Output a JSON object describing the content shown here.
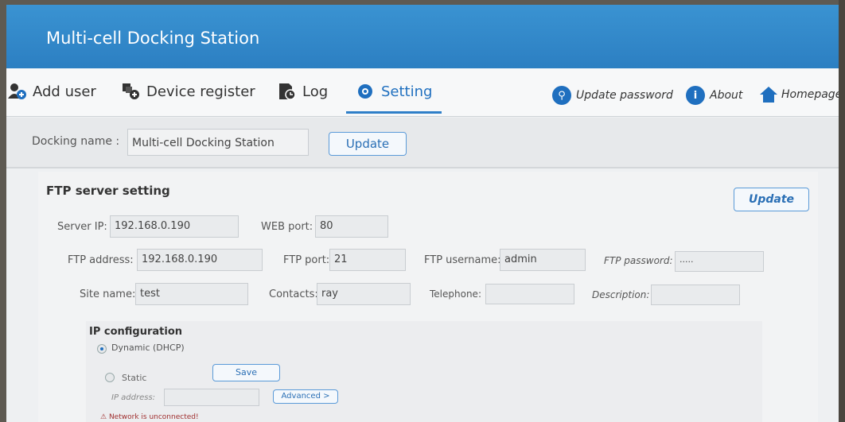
{
  "app": {
    "title": "Multi-cell Docking Station"
  },
  "nav": {
    "tabs": [
      {
        "label": "Add user",
        "icon": "add-user-icon"
      },
      {
        "label": "Device register",
        "icon": "device-register-icon"
      },
      {
        "label": "Log",
        "icon": "log-icon"
      },
      {
        "label": "Setting",
        "icon": "gear-icon"
      }
    ],
    "active_tab": "Setting",
    "links": [
      {
        "label": "Update password",
        "icon": "search-icon"
      },
      {
        "label": "About",
        "icon": "info-icon"
      },
      {
        "label": "Homepage",
        "icon": "home-icon"
      }
    ]
  },
  "docking": {
    "label": "Docking name :",
    "value": "Multi-cell Docking Station",
    "update_label": "Update"
  },
  "ftp": {
    "title": "FTP server setting",
    "update_label": "Update",
    "server_ip_label": "Server IP:",
    "server_ip": "192.168.0.190",
    "web_port_label": "WEB port:",
    "web_port": "80",
    "ftp_address_label": "FTP address:",
    "ftp_address": "192.168.0.190",
    "ftp_port_label": "FTP port:",
    "ftp_port": "21",
    "ftp_username_label": "FTP username:",
    "ftp_username": "admin",
    "ftp_password_label": "FTP password:",
    "ftp_password": "·····",
    "site_name_label": "Site name:",
    "site_name": "test",
    "contacts_label": "Contacts:",
    "contacts": "ray",
    "telephone_label": "Telephone:",
    "telephone": "",
    "description_label": "Description:",
    "description": ""
  },
  "ip": {
    "title": "IP configuration",
    "dynamic_label": "Dynamic (DHCP)",
    "static_label": "Static",
    "selected": "Dynamic (DHCP)",
    "save_label": "Save",
    "ip_address_label": "IP address:",
    "ip_address": "",
    "advanced_label": "Advanced >",
    "network_status": "Network is unconnected!"
  },
  "colors": {
    "accent": "#1f6fbf",
    "titlebar": "#2f87c8"
  }
}
